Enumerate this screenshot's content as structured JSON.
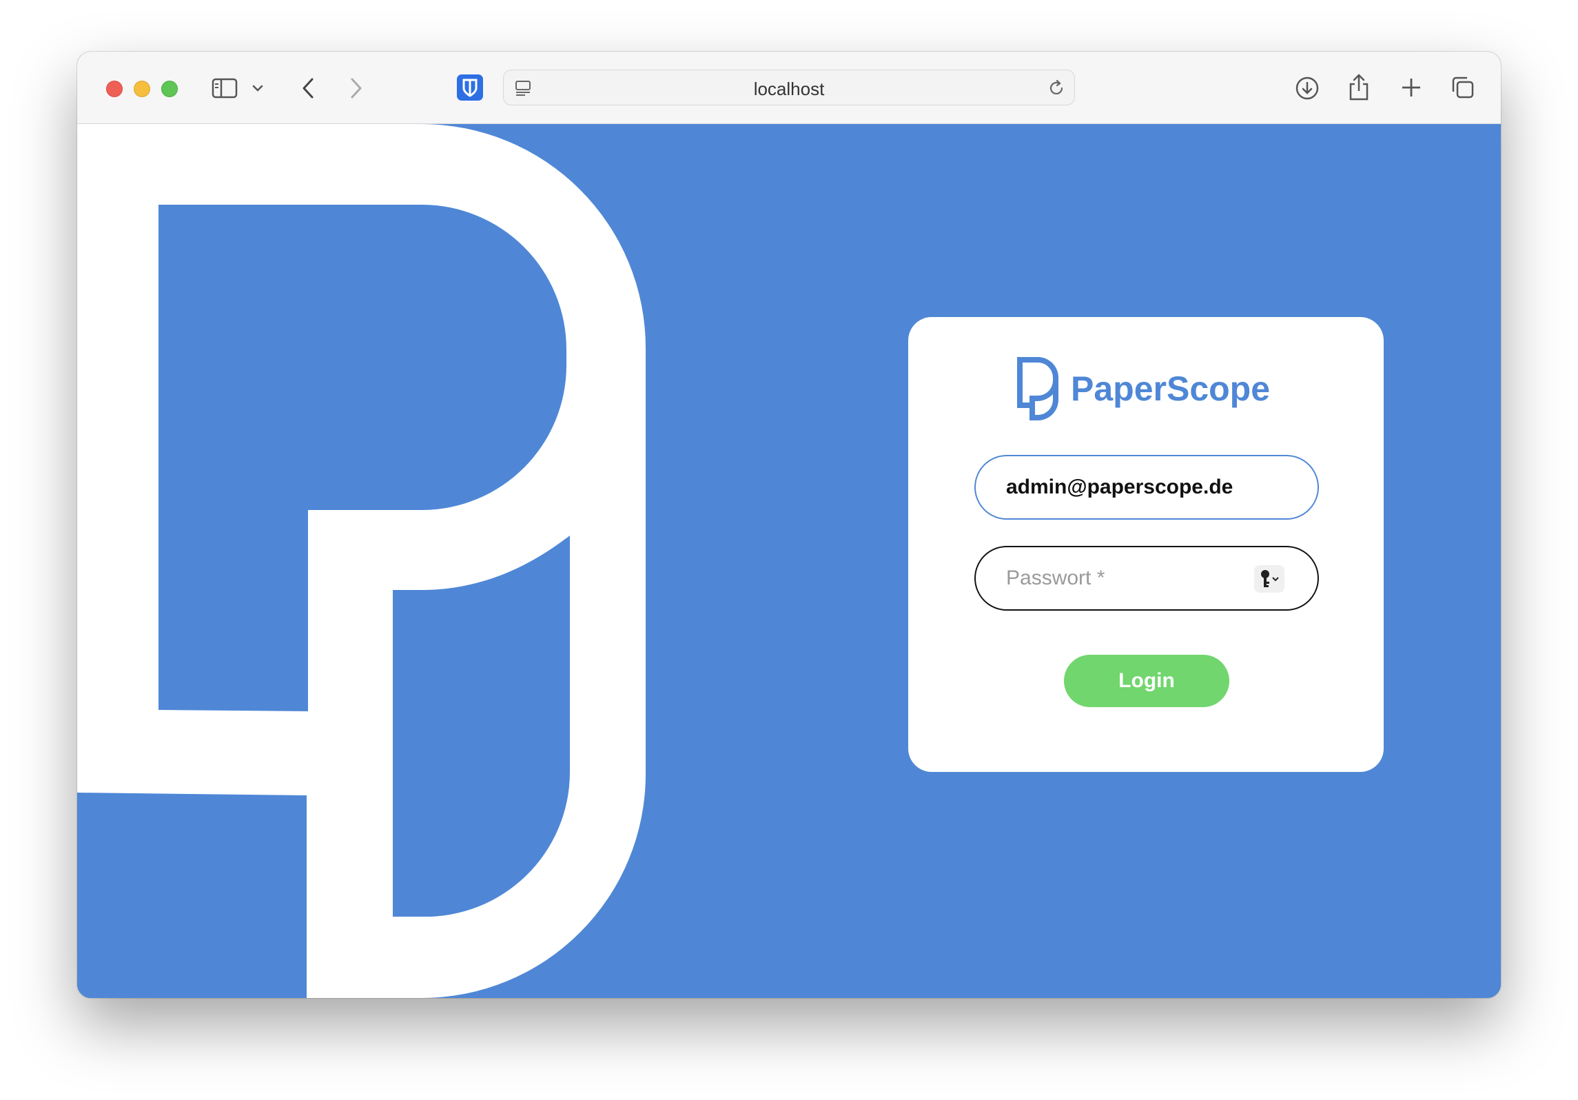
{
  "browser": {
    "address": "localhost"
  },
  "app": {
    "name": "PaperScope",
    "brand_color": "#4f87d6"
  },
  "login_form": {
    "email_value": "admin@paperscope.de",
    "password_placeholder": "Passwort *",
    "password_value": "",
    "submit_label": "Login",
    "submit_color": "#71d66d"
  },
  "icons": {
    "window_controls": [
      "close-icon",
      "minimize-icon",
      "zoom-icon"
    ],
    "toolbar": [
      "sidebar-icon",
      "chevron-down-icon",
      "back-icon",
      "forward-icon",
      "password-manager-icon",
      "page-icon",
      "reload-icon",
      "download-icon",
      "share-icon",
      "new-tab-icon",
      "tabs-overview-icon"
    ],
    "form": [
      "key-icon"
    ]
  }
}
